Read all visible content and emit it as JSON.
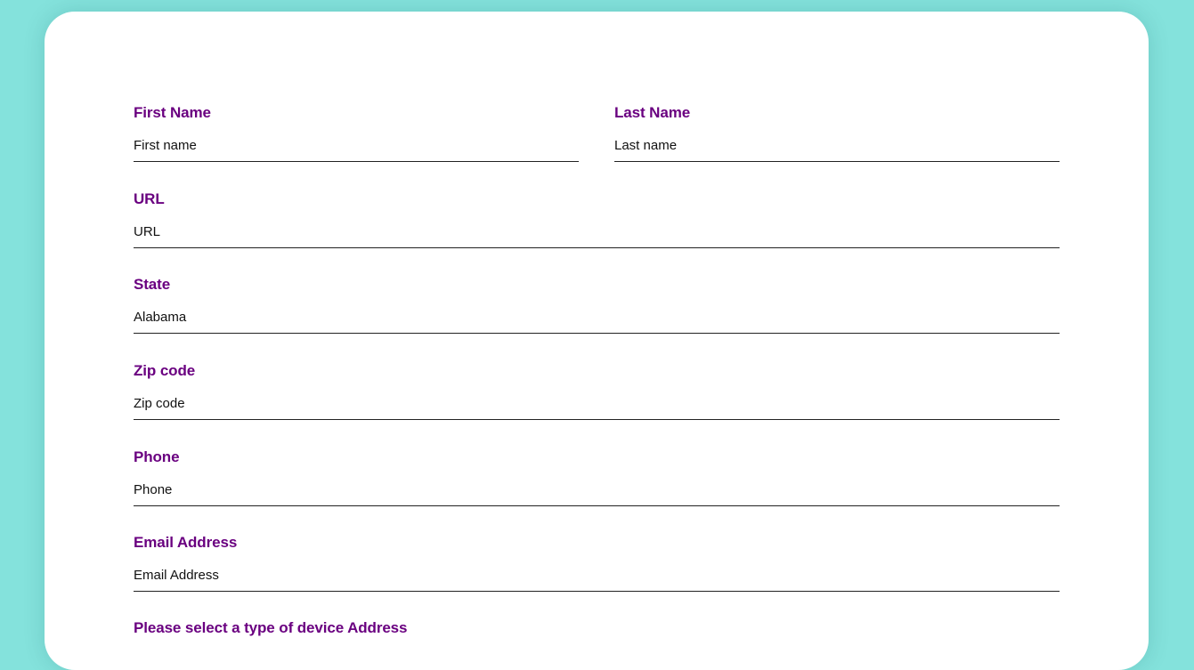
{
  "colors": {
    "background": "#84E2DC",
    "card": "#FFFFFF",
    "label": "#6A0080",
    "input_text": "#111111",
    "underline": "#222222"
  },
  "form": {
    "first_name": {
      "label": "First Name",
      "placeholder": "First name"
    },
    "last_name": {
      "label": "Last Name",
      "placeholder": "Last name"
    },
    "url": {
      "label": "URL",
      "placeholder": "URL"
    },
    "state": {
      "label": "State",
      "value": "Alabama"
    },
    "zip": {
      "label": "Zip code",
      "placeholder": "Zip code"
    },
    "phone": {
      "label": "Phone",
      "placeholder": "Phone"
    },
    "email": {
      "label": "Email Address",
      "placeholder": "Email Address"
    },
    "device_address": {
      "label": "Please select a type of device Address"
    }
  }
}
